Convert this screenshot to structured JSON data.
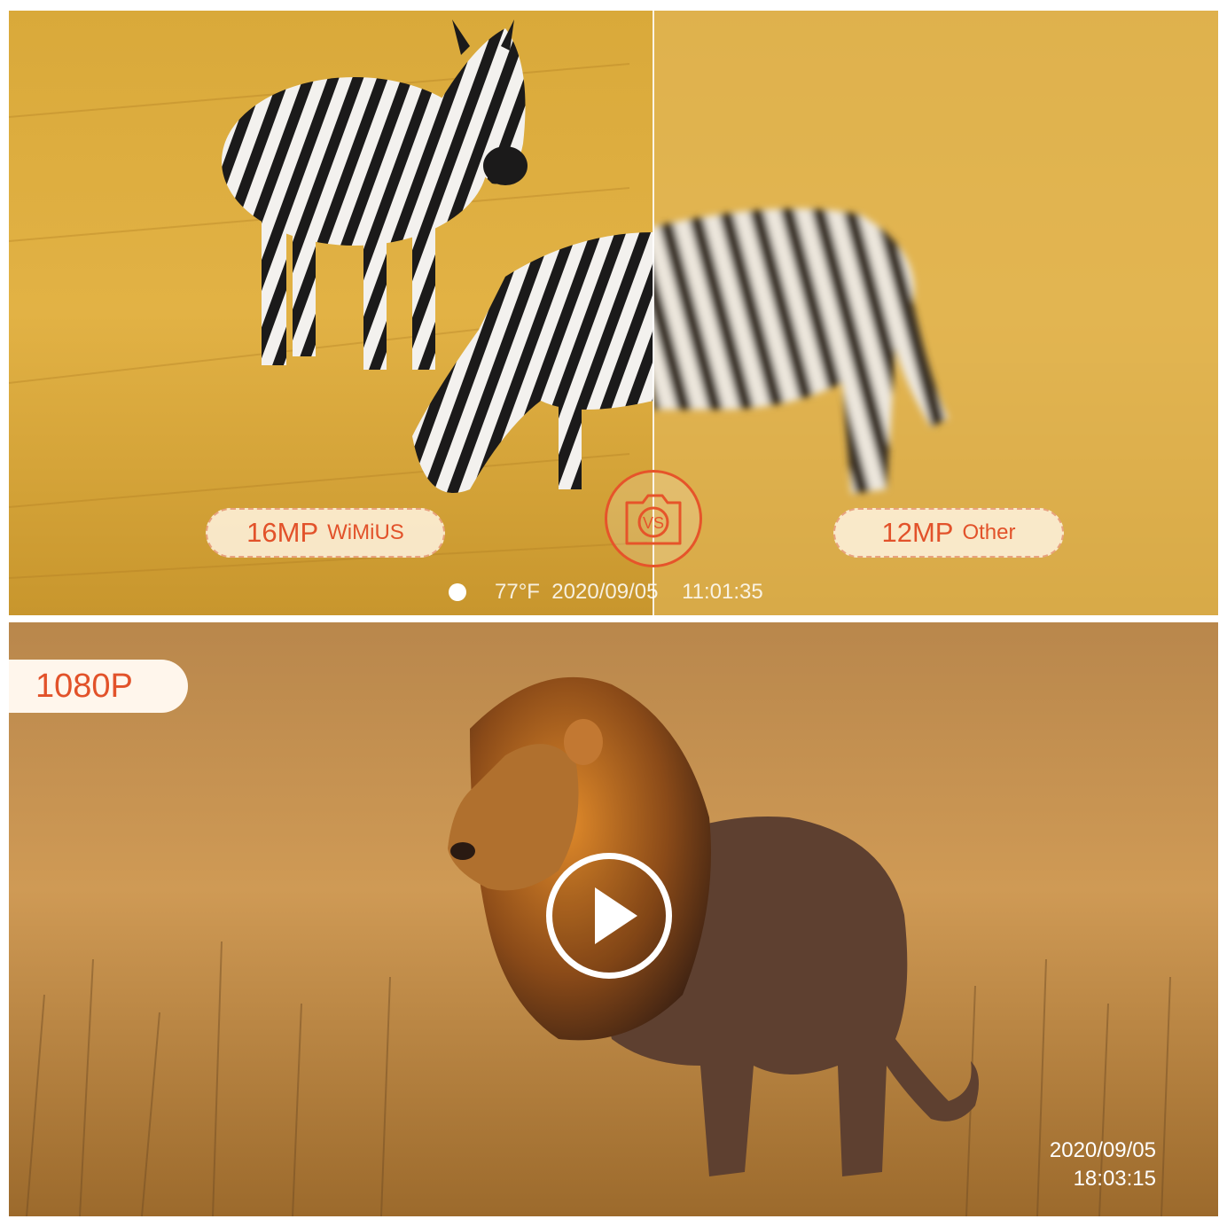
{
  "top_comparison": {
    "left_label": {
      "resolution": "16MP",
      "brand": "WiMiUS"
    },
    "right_label": {
      "resolution": "12MP",
      "brand": "Other"
    },
    "vs_badge": {
      "icon": "camera-icon",
      "text": "VS"
    },
    "info_stamp": {
      "temperature": "77°F",
      "date": "2020/09/05",
      "time": "11:01:35"
    }
  },
  "bottom_video": {
    "resolution_badge": "1080P",
    "play_icon": "play-icon",
    "timestamp": {
      "date": "2020/09/05",
      "time": "18:03:15"
    }
  },
  "colors": {
    "accent": "#e2522a",
    "label_bg": "#fceed4"
  }
}
